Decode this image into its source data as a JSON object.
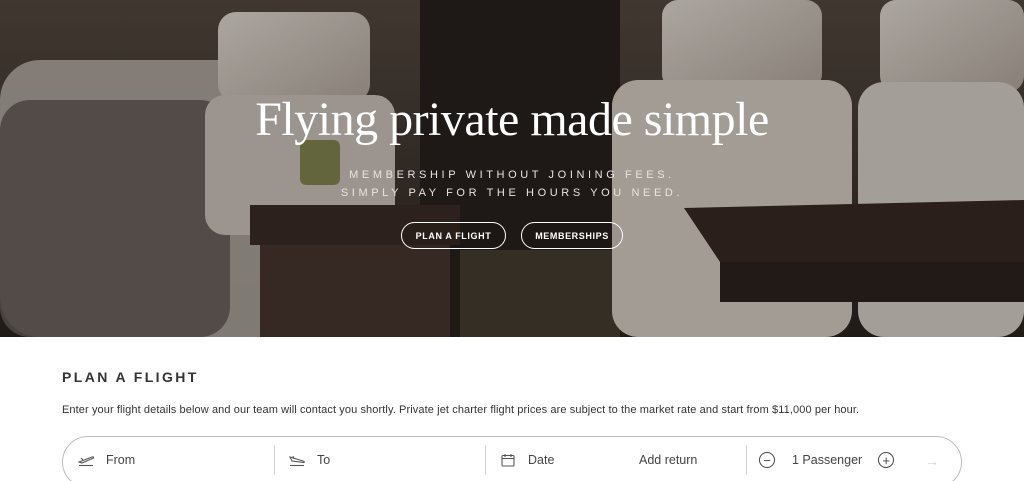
{
  "hero": {
    "title": "Flying private made simple",
    "subtitle_line1": "MEMBERSHIP WITHOUT JOINING FEES.",
    "subtitle_line2": "SIMPLY PAY FOR THE HOURS YOU NEED.",
    "buttons": [
      {
        "label": "PLAN A FLIGHT"
      },
      {
        "label": "MEMBERSHIPS"
      }
    ]
  },
  "plan": {
    "title": "PLAN A FLIGHT",
    "description": "Enter your flight details below and our team will contact you shortly. Private jet charter flight prices are subject to the market rate and start from $11,000 per hour.",
    "fields": {
      "from": {
        "placeholder": "From",
        "icon": "plane-takeoff-icon"
      },
      "to": {
        "placeholder": "To",
        "icon": "plane-landing-icon"
      },
      "date": {
        "placeholder": "Date",
        "icon": "calendar-icon"
      },
      "return": {
        "label": "Add return"
      },
      "passengers": {
        "label": "1 Passenger",
        "decrement_icon": "minus-circle-icon",
        "increment_icon": "plus-circle-icon"
      },
      "submit": {
        "icon": "arrow-right-icon"
      }
    }
  },
  "colors": {
    "hero_text": "#ffffff",
    "body_text": "#333333",
    "bar_border": "#bdbdbd"
  }
}
